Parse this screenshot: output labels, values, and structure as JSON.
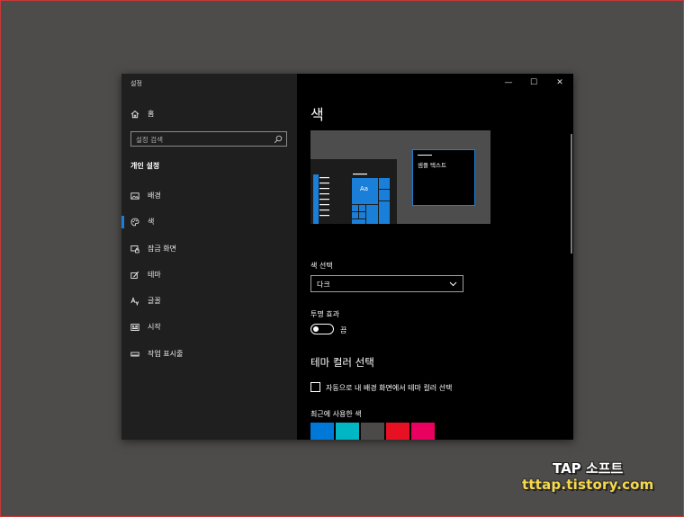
{
  "window": {
    "title": "설정",
    "controls": {
      "minimize": "—",
      "maximize": "☐",
      "close": "✕"
    }
  },
  "sidebar": {
    "home_label": "홈",
    "search_placeholder": "설정 검색",
    "section_heading": "개인 설정",
    "items": [
      {
        "label": "배경",
        "icon": "image-icon",
        "active": false
      },
      {
        "label": "색",
        "icon": "palette-icon",
        "active": true
      },
      {
        "label": "잠금 화면",
        "icon": "lock-screen-icon",
        "active": false
      },
      {
        "label": "테마",
        "icon": "theme-icon",
        "active": false
      },
      {
        "label": "글꼴",
        "icon": "font-icon",
        "active": false
      },
      {
        "label": "시작",
        "icon": "start-icon",
        "active": false
      },
      {
        "label": "작업 표시줄",
        "icon": "taskbar-icon",
        "active": false
      }
    ]
  },
  "main": {
    "title": "색",
    "preview": {
      "sample_text": "샘플 텍스트",
      "tile_label": "Aa"
    },
    "color_select": {
      "label": "색 선택",
      "value": "다크"
    },
    "transparency": {
      "label": "투명 효과",
      "state": "끔",
      "on": false
    },
    "accent_heading": "테마 컬러 선택",
    "auto_accent_label": "자동으로 내 배경 화면에서 테마 컬러 선택",
    "recent_colors_label": "최근에 사용한 색",
    "recent_colors": [
      "#0078d7",
      "#00b7c3",
      "#4c4a48",
      "#e81123",
      "#ea005e"
    ]
  },
  "accent_color": "#1a7fd8",
  "watermark": {
    "line1": "TAP 소프트",
    "line2": "tttap.tistory.com"
  }
}
